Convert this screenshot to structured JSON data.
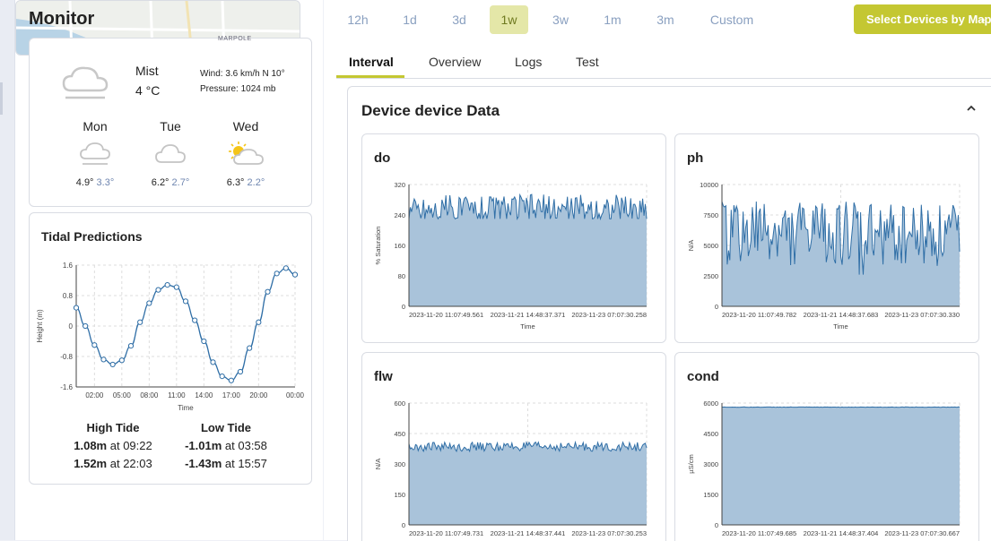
{
  "sidebar": {
    "title": "Monitor",
    "weather": {
      "condition": "Mist",
      "temp": "4 °C",
      "wind": "Wind: 3.6 km/h N 10°",
      "pressure": "Pressure: 1024 mb",
      "forecast": [
        {
          "day": "Mon",
          "icon": "fog-cloud-icon",
          "high": "4.9°",
          "low": "3.3°"
        },
        {
          "day": "Tue",
          "icon": "cloud-icon",
          "high": "6.2°",
          "low": "2.7°"
        },
        {
          "day": "Wed",
          "icon": "sun-cloud-icon",
          "high": "6.3°",
          "low": "2.2°"
        }
      ]
    },
    "tidal": {
      "title": "Tidal Predictions",
      "ylabel": "Height (m)",
      "xlabel": "Time",
      "high_label": "High Tide",
      "low_label": "Low Tide",
      "high": [
        {
          "value": "1.08m",
          "time": "at 09:22"
        },
        {
          "value": "1.52m",
          "time": "at 22:03"
        }
      ],
      "low": [
        {
          "value": "-1.01m",
          "time": "at 03:58"
        },
        {
          "value": "-1.43m",
          "time": "at 15:57"
        }
      ]
    },
    "map": {
      "label": "MARPOLE"
    }
  },
  "toolbar": {
    "ranges": [
      "12h",
      "1d",
      "3d",
      "1w",
      "3w",
      "1m",
      "3m",
      "Custom"
    ],
    "active_range": "1w",
    "map_button": "Select Devices by Map"
  },
  "tabs": [
    "Interval",
    "Overview",
    "Logs",
    "Test"
  ],
  "active_tab": "Interval",
  "panel": {
    "title": "Device device Data"
  },
  "colors": {
    "accent": "#c4c732",
    "series_line": "#2f6ea6",
    "series_fill": "#a9c3da"
  },
  "chart_data": [
    {
      "type": "line",
      "title": "Tidal Predictions",
      "ylabel": "Height (m)",
      "xlabel": "Time",
      "ylim": [
        -1.6,
        1.6
      ],
      "yticks": [
        "1.6",
        "0.8",
        "0",
        "-0.8",
        "-1.6"
      ],
      "xticks": [
        "02:00",
        "05:00",
        "08:00",
        "11:00",
        "14:00",
        "17:00",
        "20:00",
        "00:00"
      ],
      "xtick_hours": [
        2,
        5,
        8,
        11,
        14,
        17,
        20,
        24
      ],
      "hours": [
        0,
        1,
        2,
        3,
        4,
        5,
        6,
        7,
        8,
        9,
        10,
        11,
        12,
        13,
        14,
        15,
        16,
        17,
        18,
        19,
        20,
        21,
        22,
        23,
        24
      ],
      "values": [
        0.48,
        0.0,
        -0.5,
        -0.88,
        -1.01,
        -0.9,
        -0.52,
        0.1,
        0.6,
        0.95,
        1.08,
        1.02,
        0.65,
        0.15,
        -0.4,
        -0.95,
        -1.32,
        -1.43,
        -1.2,
        -0.58,
        0.1,
        0.9,
        1.38,
        1.52,
        1.35
      ],
      "grid": true
    },
    {
      "type": "area",
      "title": "do",
      "ylabel": "% Saturation",
      "xlabel": "Time",
      "ylim": [
        0,
        320
      ],
      "yticks": [
        "320",
        "240",
        "160",
        "80",
        "0"
      ],
      "xticks": [
        "2023-11-20 11:07:49.561",
        "2023-11-21 14:48:37.371",
        "2023-11-23 07:07:30.258"
      ],
      "series": [
        {
          "values_summary": {
            "baseline": 255,
            "min": 230,
            "max": 318
          }
        }
      ],
      "grid": true
    },
    {
      "type": "area",
      "title": "ph",
      "ylabel": "N/A",
      "xlabel": "Time",
      "ylim": [
        0,
        10000
      ],
      "yticks": [
        "10000",
        "7500",
        "5000",
        "2500",
        "0"
      ],
      "xticks": [
        "2023-11-20 11:07:49.782",
        "2023-11-21 14:48:37.683",
        "2023-11-23 07:07:30.330"
      ],
      "series": [
        {
          "values_summary": {
            "baseline": 6000,
            "min": 2600,
            "max": 8600
          }
        }
      ],
      "grid": true
    },
    {
      "type": "area",
      "title": "flw",
      "ylabel": "N/A",
      "xlabel": "Time",
      "ylim": [
        0,
        600
      ],
      "yticks": [
        "600",
        "450",
        "300",
        "150",
        "0"
      ],
      "xticks": [
        "2023-11-20 11:07:49.731",
        "2023-11-21 14:48:37.441",
        "2023-11-23 07:07:30.253"
      ],
      "series": [
        {
          "values_summary": {
            "baseline": 385,
            "min": 360,
            "max": 410
          }
        }
      ],
      "grid": true
    },
    {
      "type": "area",
      "title": "cond",
      "ylabel": "µS/cm",
      "xlabel": "Time",
      "ylim": [
        0,
        6000
      ],
      "yticks": [
        "6000",
        "4500",
        "3000",
        "1500",
        "0"
      ],
      "xticks": [
        "2023-11-20 11:07:49.685",
        "2023-11-21 14:48:37.404",
        "2023-11-23 07:07:30.667"
      ],
      "series": [
        {
          "values_summary": {
            "baseline": 5800,
            "min": 5790,
            "max": 5810
          }
        }
      ],
      "grid": true
    }
  ]
}
